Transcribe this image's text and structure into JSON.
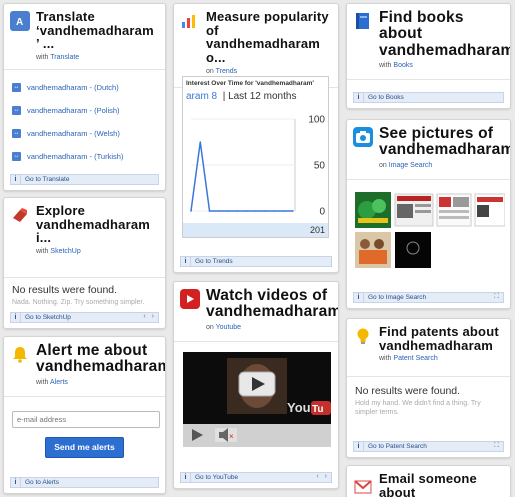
{
  "translate": {
    "title": "Translate ‘vandhemadharam ’ ...",
    "with_prefix": "with",
    "with_link": "Translate",
    "items": [
      {
        "label": "vandhemadharam - (Dutch)"
      },
      {
        "label": "vandhemadharam - (Polish)"
      },
      {
        "label": "vandhemadharam - (Welsh)"
      },
      {
        "label": "vandhemadharam - (Turkish)"
      }
    ],
    "goto": "Go to Translate"
  },
  "sketchup": {
    "title": "Explore vandhemadharam i...",
    "with_prefix": "with",
    "with_link": "SketchUp",
    "no_results": "No results were found.",
    "no_results_sub": "Nada. Nothing. Zip. Try something simpler.",
    "goto": "Go to SketchUp"
  },
  "alerts": {
    "title": "Alert me about vandhemadharam",
    "with_prefix": "with",
    "with_link": "Alerts",
    "email_placeholder": "e-mail address",
    "send_label": "Send me alerts",
    "goto": "Go to Alerts"
  },
  "trends": {
    "title": "Measure popularity of vandhemadharam o...",
    "with_prefix": "on",
    "with_link": "Trends",
    "chart_caption": "Interest Over Time for 'vandhemadharam'",
    "chart_sub_accent": "aram 8",
    "chart_sub": "| Last 12 months",
    "footer_value": "201",
    "goto": "Go to Trends"
  },
  "chart_data": {
    "type": "line",
    "title": "Interest Over Time for 'vandhemadharam'",
    "ylim": [
      0,
      100
    ],
    "yticks": [
      100,
      50,
      0
    ],
    "series": [
      {
        "values": [
          0,
          75,
          0,
          0,
          0,
          0,
          0,
          0,
          0,
          0,
          0,
          0
        ]
      }
    ]
  },
  "youtube": {
    "title": "Watch videos of vandhemadharam",
    "with_prefix": "on",
    "with_link": "Youtube",
    "goto": "Go to YouTube"
  },
  "books": {
    "title": "Find books about vandhemadharam",
    "with_prefix": "with",
    "with_link": "Books",
    "goto": "Go to Books"
  },
  "images": {
    "title": "See pictures of vandhemadharam",
    "with_prefix": "on",
    "with_link": "Image Search",
    "goto": "Go to Image Search"
  },
  "patents": {
    "title": "Find patents about vandhemadharam",
    "with_prefix": "with",
    "with_link": "Patent Search",
    "no_results": "No results were found.",
    "no_results_sub": "Hold my hand. We didn't find a thing. Try simpler terms.",
    "goto": "Go to Patent Search"
  },
  "gmail": {
    "title": "Email someone about vandhemadharam"
  },
  "colors": {
    "accent": "#2c6fd0",
    "link": "#2a63b7",
    "youtube_red": "#d32121"
  }
}
